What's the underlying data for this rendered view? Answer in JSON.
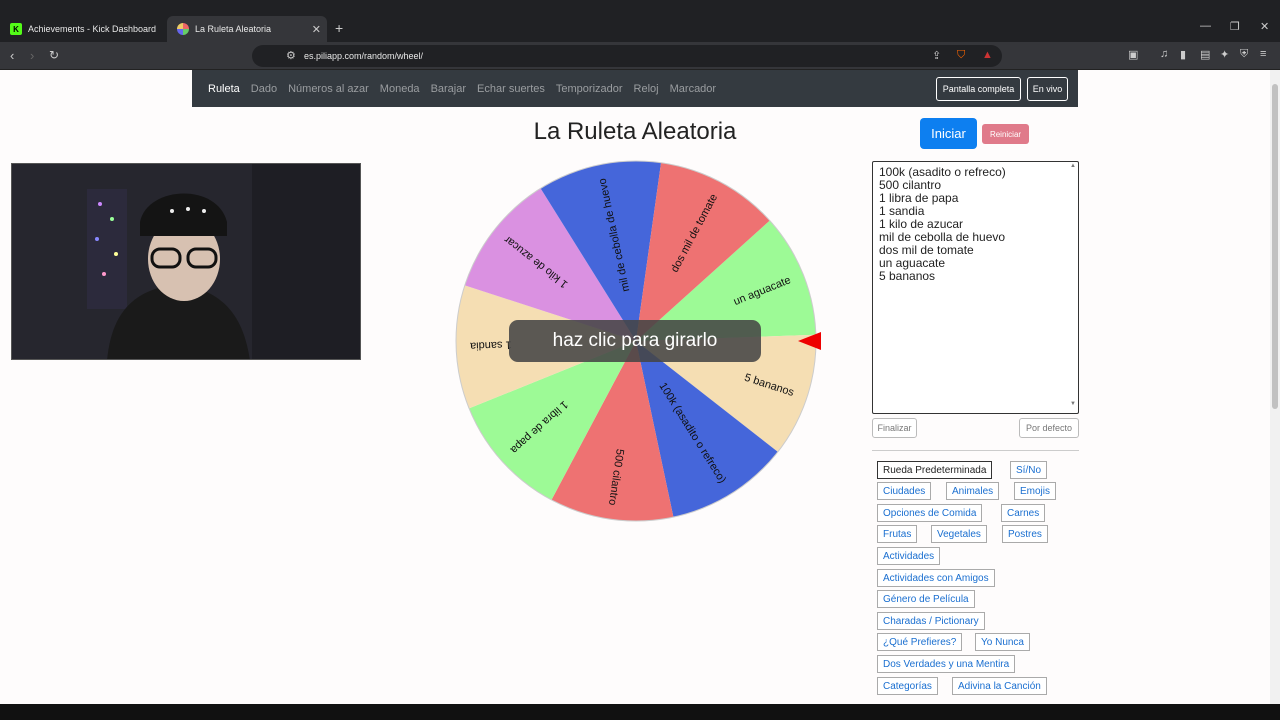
{
  "browser": {
    "tabs": [
      {
        "title": "Achievements - Kick Dashboard",
        "icon": "kick-logo-icon"
      },
      {
        "title": "La Ruleta Aleatoria",
        "icon": "wheel-favicon-icon"
      }
    ],
    "url": "es.piliapp.com/random/wheel/"
  },
  "site_nav": {
    "items": [
      "Ruleta",
      "Dado",
      "Números al azar",
      "Moneda",
      "Barajar",
      "Echar suertes",
      "Temporizador",
      "Reloj",
      "Marcador"
    ],
    "fullscreen_label": "Pantalla completa",
    "live_label": "En vivo"
  },
  "page": {
    "title": "La Ruleta Aleatoria",
    "start_label": "Iniciar",
    "reset_label": "Reiniciar",
    "spin_hint": "haz clic para girarlo",
    "entries_text": "100k (asadito o refreco)\n500 cilantro\n1 libra de papa\n1 sandia\n1 kilo de azucar\nmil de cebolla de huevo\ndos mil de tomate\nun aguacate\n5 bananos",
    "finalize_label": "Finalizar",
    "default_label": "Por defecto"
  },
  "wheel": {
    "segments": [
      {
        "label": "un aguacate",
        "color": "#9dfa96"
      },
      {
        "label": "5 bananos",
        "color": "#f5deb3"
      },
      {
        "label": "100k (asadito o refreco)",
        "color": "#4566da"
      },
      {
        "label": "500 cilantro",
        "color": "#ee7272"
      },
      {
        "label": "1 libra de papa",
        "color": "#9dfa96"
      },
      {
        "label": "1 sandia",
        "color": "#f5deb3"
      },
      {
        "label": "1 kilo de azucar",
        "color": "#da91e1"
      },
      {
        "label": "mil de cebolla de huevo",
        "color": "#4566da"
      },
      {
        "label": "dos mil de tomate",
        "color": "#ee7272"
      }
    ]
  },
  "presets": [
    "Rueda Predeterminada",
    "Sí/No",
    "Ciudades",
    "Animales",
    "Emojis",
    "Opciones de Comida",
    "Carnes",
    "Frutas",
    "Vegetales",
    "Postres",
    "Actividades",
    "Actividades con Amigos",
    "Género de Película",
    "Charadas / Pictionary",
    "¿Qué Prefieres?",
    "Yo Nunca",
    "Dos Verdades y una Mentira",
    "Categorías",
    "Adivina la Canción"
  ]
}
